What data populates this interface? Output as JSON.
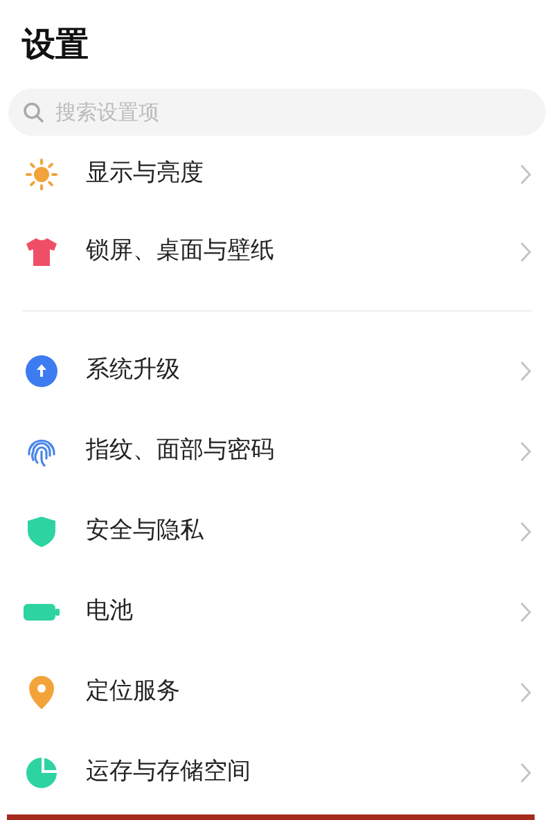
{
  "title": "设置",
  "search": {
    "placeholder": "搜索设置项"
  },
  "groups": [
    {
      "items": [
        {
          "kind": "sun",
          "label": "显示与亮度"
        },
        {
          "kind": "shirt",
          "label": "锁屏、桌面与壁纸"
        }
      ]
    },
    {
      "items": [
        {
          "kind": "upgrade",
          "label": "系统升级"
        },
        {
          "kind": "fingerprint",
          "label": "指纹、面部与密码"
        },
        {
          "kind": "shield",
          "label": "安全与隐私"
        },
        {
          "kind": "battery",
          "label": "电池"
        },
        {
          "kind": "location",
          "label": "定位服务"
        },
        {
          "kind": "pie",
          "label": "运存与存储空间"
        }
      ]
    }
  ]
}
